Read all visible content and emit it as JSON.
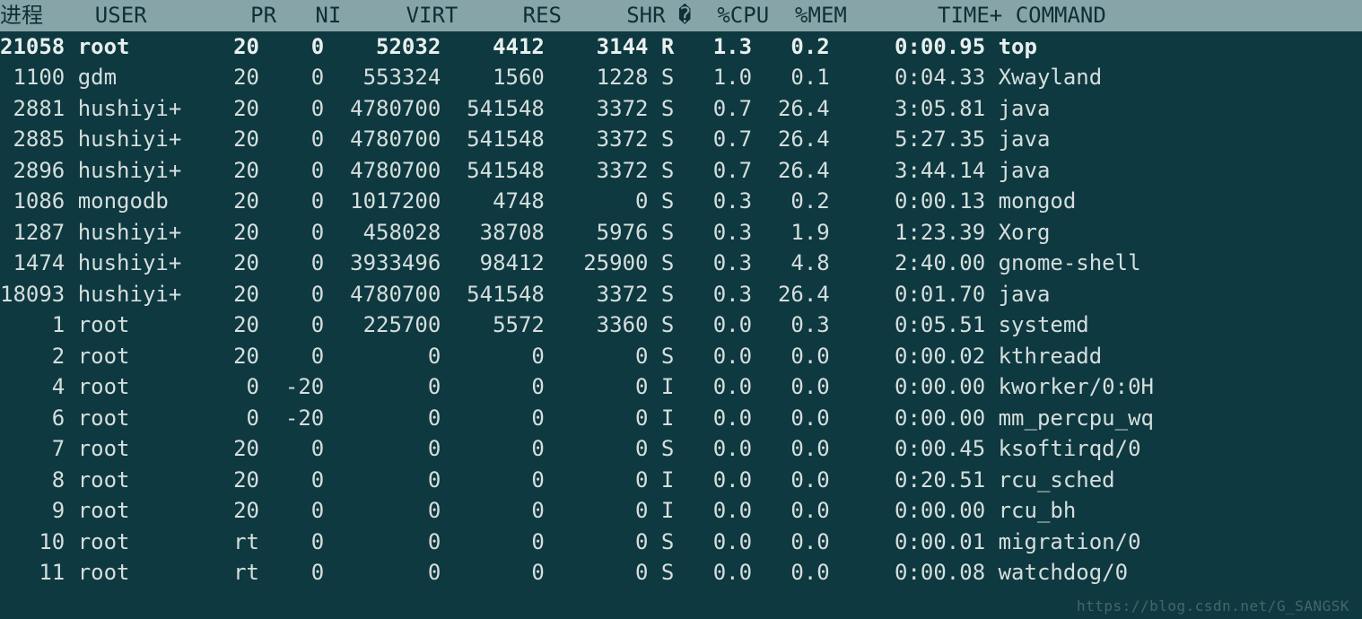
{
  "watermark": "https://blog.csdn.net/G_SANGSK",
  "columns": {
    "pid": "进程",
    "user": "USER",
    "pr": "PR",
    "ni": "NI",
    "virt": "VIRT",
    "res": "RES",
    "shr": "SHR",
    "s": "�",
    "cpu": "%CPU",
    "mem": "%MEM",
    "time": "TIME+",
    "command": "COMMAND"
  },
  "rows": [
    {
      "pid": "21058",
      "user": "root",
      "pr": "20",
      "ni": "0",
      "virt": "52032",
      "res": "4412",
      "shr": "3144",
      "s": "R",
      "cpu": "1.3",
      "mem": "0.2",
      "time": "0:00.95",
      "command": "top",
      "bold": true
    },
    {
      "pid": "1100",
      "user": "gdm",
      "pr": "20",
      "ni": "0",
      "virt": "553324",
      "res": "1560",
      "shr": "1228",
      "s": "S",
      "cpu": "1.0",
      "mem": "0.1",
      "time": "0:04.33",
      "command": "Xwayland",
      "bold": false
    },
    {
      "pid": "2881",
      "user": "hushiyi+",
      "pr": "20",
      "ni": "0",
      "virt": "4780700",
      "res": "541548",
      "shr": "3372",
      "s": "S",
      "cpu": "0.7",
      "mem": "26.4",
      "time": "3:05.81",
      "command": "java",
      "bold": false
    },
    {
      "pid": "2885",
      "user": "hushiyi+",
      "pr": "20",
      "ni": "0",
      "virt": "4780700",
      "res": "541548",
      "shr": "3372",
      "s": "S",
      "cpu": "0.7",
      "mem": "26.4",
      "time": "5:27.35",
      "command": "java",
      "bold": false
    },
    {
      "pid": "2896",
      "user": "hushiyi+",
      "pr": "20",
      "ni": "0",
      "virt": "4780700",
      "res": "541548",
      "shr": "3372",
      "s": "S",
      "cpu": "0.7",
      "mem": "26.4",
      "time": "3:44.14",
      "command": "java",
      "bold": false
    },
    {
      "pid": "1086",
      "user": "mongodb",
      "pr": "20",
      "ni": "0",
      "virt": "1017200",
      "res": "4748",
      "shr": "0",
      "s": "S",
      "cpu": "0.3",
      "mem": "0.2",
      "time": "0:00.13",
      "command": "mongod",
      "bold": false
    },
    {
      "pid": "1287",
      "user": "hushiyi+",
      "pr": "20",
      "ni": "0",
      "virt": "458028",
      "res": "38708",
      "shr": "5976",
      "s": "S",
      "cpu": "0.3",
      "mem": "1.9",
      "time": "1:23.39",
      "command": "Xorg",
      "bold": false
    },
    {
      "pid": "1474",
      "user": "hushiyi+",
      "pr": "20",
      "ni": "0",
      "virt": "3933496",
      "res": "98412",
      "shr": "25900",
      "s": "S",
      "cpu": "0.3",
      "mem": "4.8",
      "time": "2:40.00",
      "command": "gnome-shell",
      "bold": false
    },
    {
      "pid": "18093",
      "user": "hushiyi+",
      "pr": "20",
      "ni": "0",
      "virt": "4780700",
      "res": "541548",
      "shr": "3372",
      "s": "S",
      "cpu": "0.3",
      "mem": "26.4",
      "time": "0:01.70",
      "command": "java",
      "bold": false
    },
    {
      "pid": "1",
      "user": "root",
      "pr": "20",
      "ni": "0",
      "virt": "225700",
      "res": "5572",
      "shr": "3360",
      "s": "S",
      "cpu": "0.0",
      "mem": "0.3",
      "time": "0:05.51",
      "command": "systemd",
      "bold": false
    },
    {
      "pid": "2",
      "user": "root",
      "pr": "20",
      "ni": "0",
      "virt": "0",
      "res": "0",
      "shr": "0",
      "s": "S",
      "cpu": "0.0",
      "mem": "0.0",
      "time": "0:00.02",
      "command": "kthreadd",
      "bold": false
    },
    {
      "pid": "4",
      "user": "root",
      "pr": "0",
      "ni": "-20",
      "virt": "0",
      "res": "0",
      "shr": "0",
      "s": "I",
      "cpu": "0.0",
      "mem": "0.0",
      "time": "0:00.00",
      "command": "kworker/0:0H",
      "bold": false
    },
    {
      "pid": "6",
      "user": "root",
      "pr": "0",
      "ni": "-20",
      "virt": "0",
      "res": "0",
      "shr": "0",
      "s": "I",
      "cpu": "0.0",
      "mem": "0.0",
      "time": "0:00.00",
      "command": "mm_percpu_wq",
      "bold": false
    },
    {
      "pid": "7",
      "user": "root",
      "pr": "20",
      "ni": "0",
      "virt": "0",
      "res": "0",
      "shr": "0",
      "s": "S",
      "cpu": "0.0",
      "mem": "0.0",
      "time": "0:00.45",
      "command": "ksoftirqd/0",
      "bold": false
    },
    {
      "pid": "8",
      "user": "root",
      "pr": "20",
      "ni": "0",
      "virt": "0",
      "res": "0",
      "shr": "0",
      "s": "I",
      "cpu": "0.0",
      "mem": "0.0",
      "time": "0:20.51",
      "command": "rcu_sched",
      "bold": false
    },
    {
      "pid": "9",
      "user": "root",
      "pr": "20",
      "ni": "0",
      "virt": "0",
      "res": "0",
      "shr": "0",
      "s": "I",
      "cpu": "0.0",
      "mem": "0.0",
      "time": "0:00.00",
      "command": "rcu_bh",
      "bold": false
    },
    {
      "pid": "10",
      "user": "root",
      "pr": "rt",
      "ni": "0",
      "virt": "0",
      "res": "0",
      "shr": "0",
      "s": "S",
      "cpu": "0.0",
      "mem": "0.0",
      "time": "0:00.01",
      "command": "migration/0",
      "bold": false
    },
    {
      "pid": "11",
      "user": "root",
      "pr": "rt",
      "ni": "0",
      "virt": "0",
      "res": "0",
      "shr": "0",
      "s": "S",
      "cpu": "0.0",
      "mem": "0.0",
      "time": "0:00.08",
      "command": "watchdog/0",
      "bold": false
    }
  ]
}
